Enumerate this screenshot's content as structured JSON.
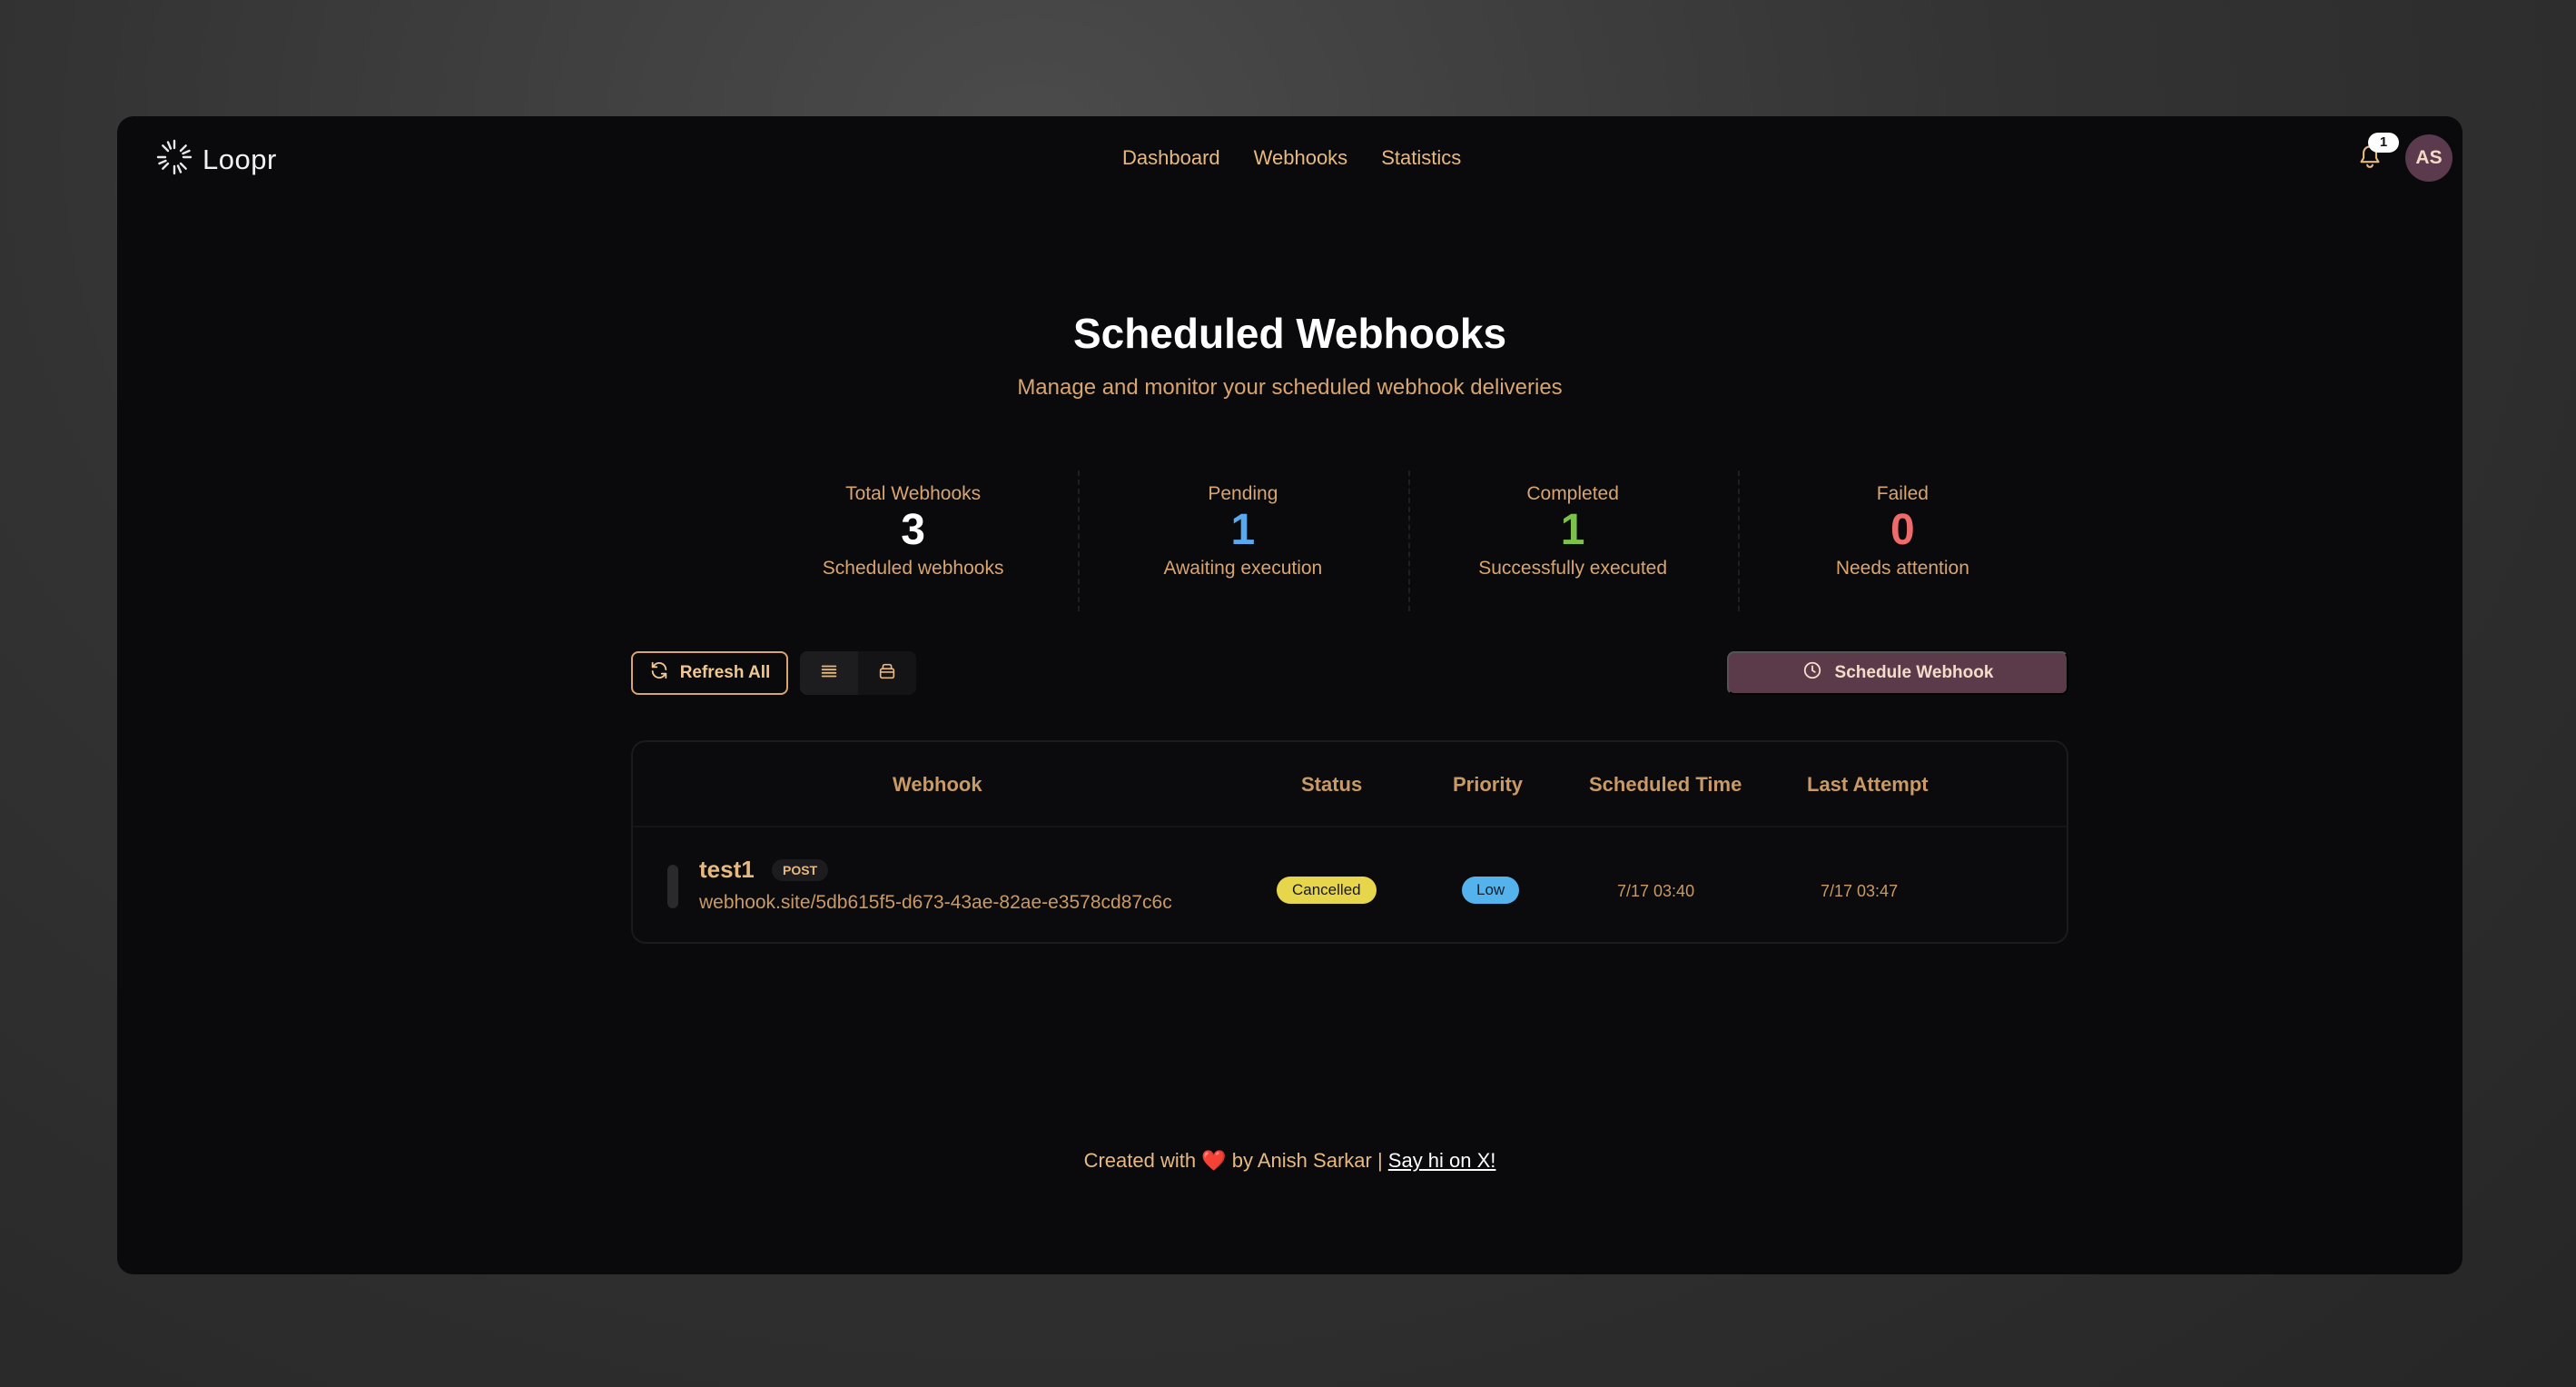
{
  "app": {
    "name": "Loopr"
  },
  "nav": {
    "items": [
      "Dashboard",
      "Webhooks",
      "Statistics"
    ]
  },
  "notifications": {
    "count": "1"
  },
  "user": {
    "initials": "AS"
  },
  "page": {
    "title": "Scheduled Webhooks",
    "subtitle": "Manage and monitor your scheduled webhook deliveries"
  },
  "stats": [
    {
      "label": "Total Webhooks",
      "value": "3",
      "desc": "Scheduled webhooks",
      "color": "#ffffff"
    },
    {
      "label": "Pending",
      "value": "1",
      "desc": "Awaiting execution",
      "color": "#5aa9ef"
    },
    {
      "label": "Completed",
      "value": "1",
      "desc": "Successfully executed",
      "color": "#7cc24a"
    },
    {
      "label": "Failed",
      "value": "0",
      "desc": "Needs attention",
      "color": "#ef6b6b"
    }
  ],
  "toolbar": {
    "refresh_label": "Refresh All",
    "schedule_label": "Schedule Webhook"
  },
  "table": {
    "columns": [
      "Webhook",
      "Status",
      "Priority",
      "Scheduled Time",
      "Last Attempt"
    ],
    "rows": [
      {
        "name": "test1",
        "method": "POST",
        "url": "webhook.site/5db615f5-d673-43ae-82ae-e3578cd87c6c",
        "status": "Cancelled",
        "priority": "Low",
        "scheduled_time": "7/17 03:40",
        "last_attempt": "7/17 03:47"
      }
    ]
  },
  "footer": {
    "prefix": "Created with",
    "heart": "❤️",
    "by": "by Anish Sarkar |",
    "link": "Say hi on X!"
  },
  "colors": {
    "accent": "#e6b980",
    "status_cancelled": "#e7d54b",
    "priority_low": "#54b3ec",
    "schedule_button": "#5b3a4a"
  }
}
